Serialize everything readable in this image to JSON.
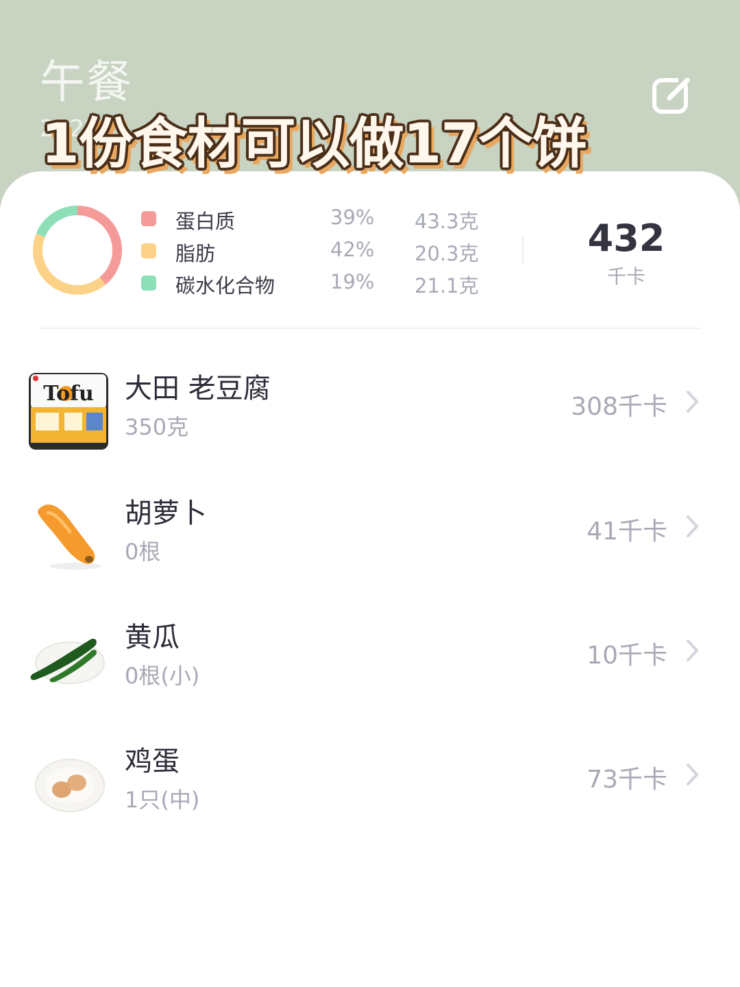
{
  "header": {
    "title": "午餐",
    "date_partial": "2022",
    "edit_icon": "edit-icon"
  },
  "overlay_caption": "1份食材可以做17个饼",
  "summary": {
    "macros": [
      {
        "name": "蛋白质",
        "percent": "39%",
        "grams": "43.3克",
        "color": "#f49a98",
        "fraction": 0.39
      },
      {
        "name": "脂肪",
        "percent": "42%",
        "grams": "20.3克",
        "color": "#fcd289",
        "fraction": 0.42
      },
      {
        "name": "碳水化合物",
        "percent": "19%",
        "grams": "21.1克",
        "color": "#8ddfb8",
        "fraction": 0.19
      }
    ],
    "total_kcal": "432",
    "kcal_unit": "千卡"
  },
  "foods": [
    {
      "name": "大田 老豆腐",
      "amount": "350克",
      "kcal": "308千卡",
      "icon": "tofu-package-icon"
    },
    {
      "name": "胡萝卜",
      "amount": "0根",
      "kcal": "41千卡",
      "icon": "carrot-icon"
    },
    {
      "name": "黄瓜",
      "amount": "0根(小)",
      "kcal": "10千卡",
      "icon": "cucumber-icon"
    },
    {
      "name": "鸡蛋",
      "amount": "1只(中)",
      "kcal": "73千卡",
      "icon": "egg-icon"
    }
  ],
  "tofu_logo_text": "Tofu",
  "colors": {
    "header_bg": "#c8d3c2",
    "card_bg": "#ffffff",
    "muted_text": "#a7a9b5",
    "primary_text": "#2b2c38"
  }
}
